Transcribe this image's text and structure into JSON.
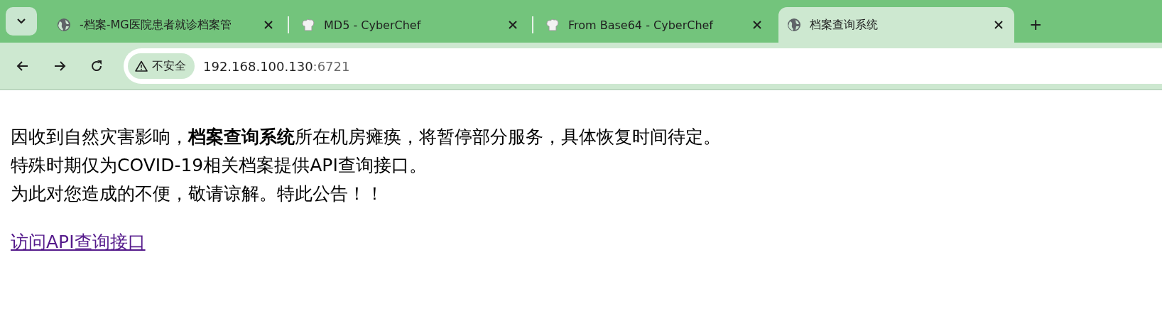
{
  "tabs": [
    {
      "kind": "globe",
      "title": "-档案-MG医院患者就诊档案管",
      "selected": false
    },
    {
      "kind": "chef",
      "title": "MD5 - CyberChef",
      "selected": false
    },
    {
      "kind": "chef",
      "title": "From Base64 - CyberChef",
      "selected": false
    },
    {
      "kind": "globe",
      "title": "档案查询系统",
      "selected": true
    }
  ],
  "new_tab": "+",
  "address_bar": {
    "security": "不安全",
    "host": "192.168.100.130",
    "port": ":6721"
  },
  "page": {
    "notice_lines": [
      "因收到自然灾害影响，**档案查询系统**所在机房瘫痪，将暂停部分服务，具体恢复时间待定。",
      "特殊时期仅为COVID-19相关档案提供API查询接口。",
      "为此对您造成的不便，敬请谅解。特此公告！！"
    ],
    "link": "访问API查询接口"
  }
}
